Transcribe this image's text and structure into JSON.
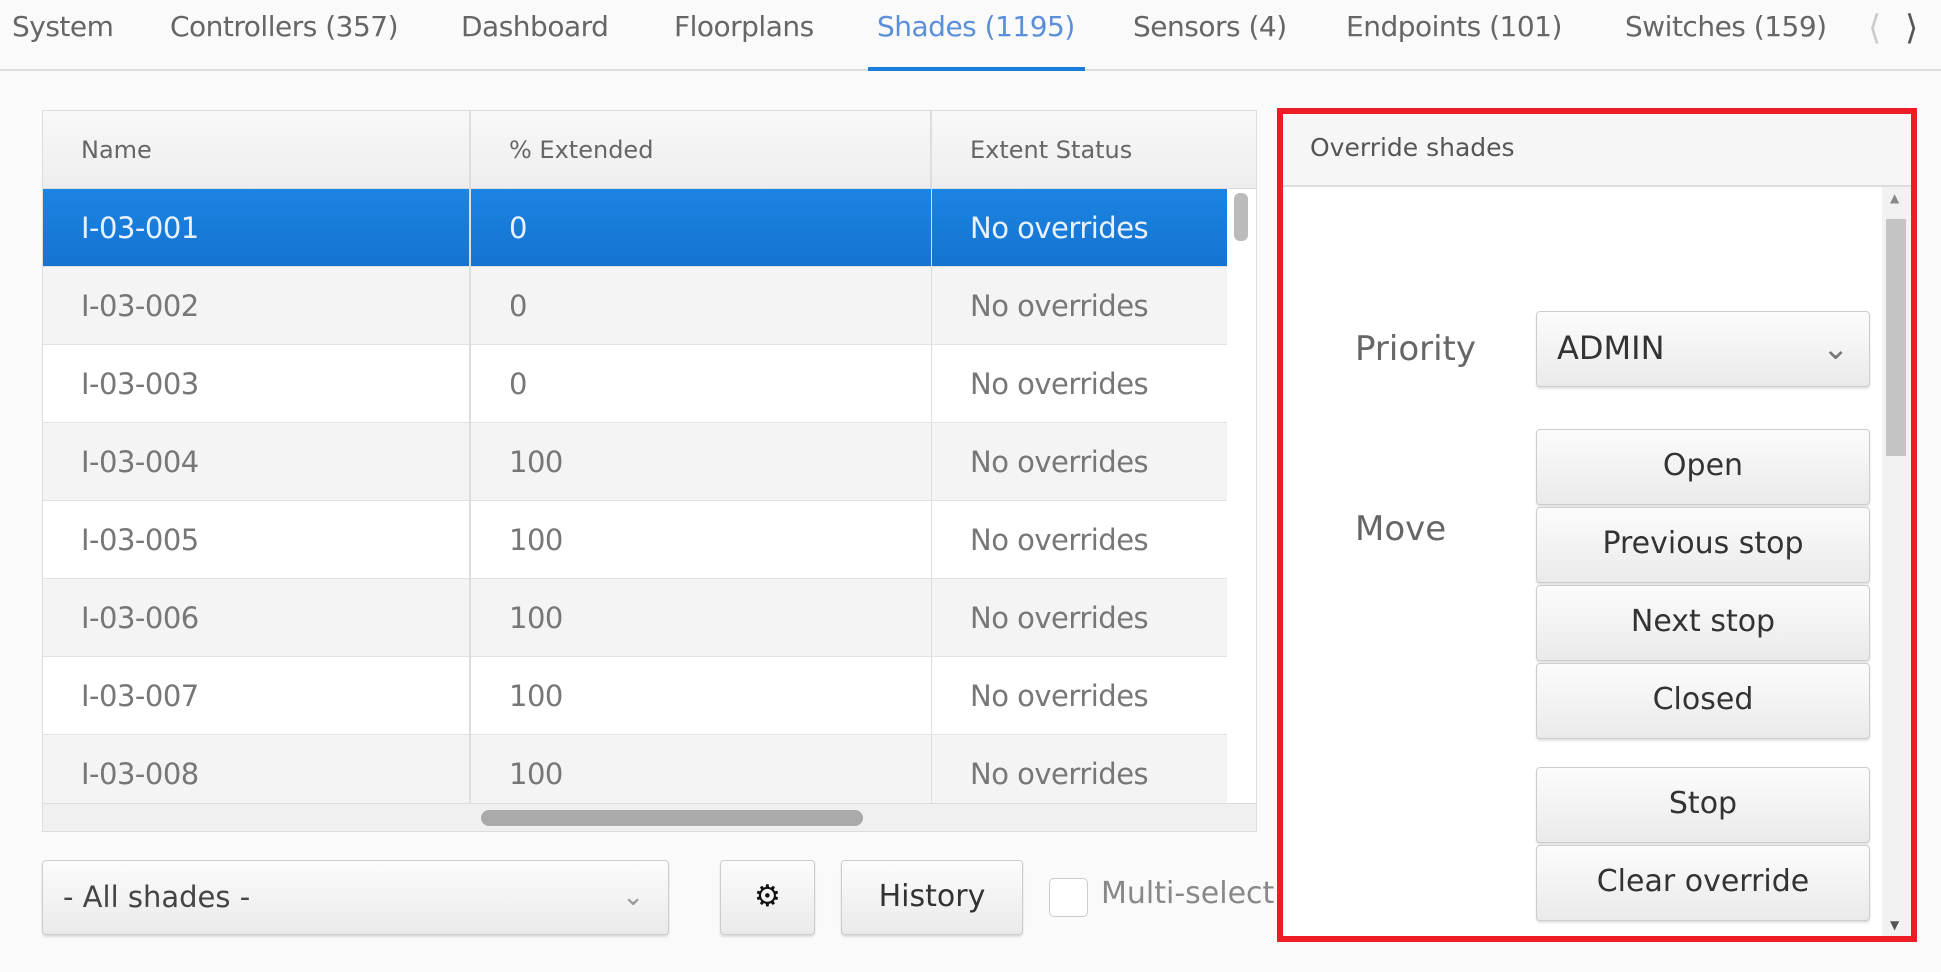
{
  "tabs": [
    "System",
    "Controllers (357)",
    "Dashboard",
    "Floorplans",
    "Shades (1195)",
    "Sensors (4)",
    "Endpoints (101)",
    "Switches (159)"
  ],
  "active_tab": "Shades (1195)",
  "table": {
    "columns": [
      "Name",
      "% Extended",
      "Extent Status"
    ],
    "rows": [
      [
        "I-03-001",
        "0",
        "No overrides"
      ],
      [
        "I-03-002",
        "0",
        "No overrides"
      ],
      [
        "I-03-003",
        "0",
        "No overrides"
      ],
      [
        "I-03-004",
        "100",
        "No overrides"
      ],
      [
        "I-03-005",
        "100",
        "No overrides"
      ],
      [
        "I-03-006",
        "100",
        "No overrides"
      ],
      [
        "I-03-007",
        "100",
        "No overrides"
      ],
      [
        "I-03-008",
        "100",
        "No overrides"
      ]
    ],
    "selected_row": 0
  },
  "footer": {
    "filter": "- All shades -",
    "history": "History",
    "multiselect": "Multi-select"
  },
  "panel": {
    "title": "Override shades",
    "priority_label": "Priority",
    "priority_value": "ADMIN",
    "move_label": "Move",
    "buttons": [
      "Open",
      "Previous stop",
      "Next stop",
      "Closed",
      "Stop",
      "Clear override"
    ]
  },
  "colors": {
    "accent": "#1a7fdb",
    "highlight": "#ee1c25"
  }
}
